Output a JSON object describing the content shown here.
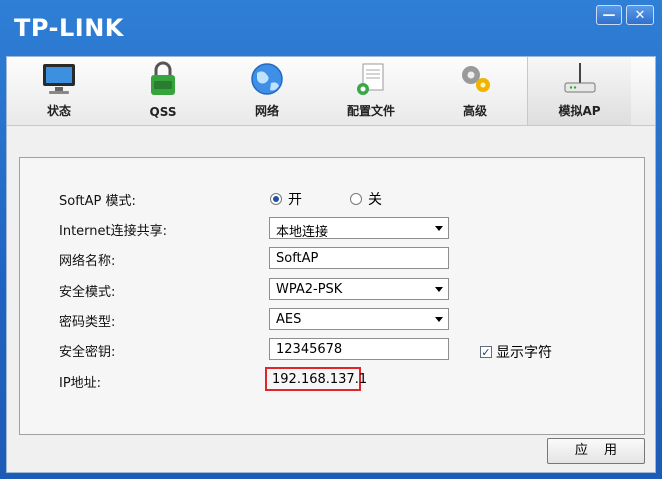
{
  "app": {
    "brand": "TP-LINK"
  },
  "window_controls": {
    "minimize": "—",
    "close": "✕"
  },
  "tabs": [
    {
      "label": "状态",
      "icon": "monitor-icon"
    },
    {
      "label": "QSS",
      "icon": "qss-lock-icon"
    },
    {
      "label": "网络",
      "icon": "globe-icon"
    },
    {
      "label": "配置文件",
      "icon": "document-gear-icon"
    },
    {
      "label": "高级",
      "icon": "gears-icon"
    },
    {
      "label": "模拟AP",
      "icon": "router-icon",
      "active": true
    }
  ],
  "form": {
    "softap_mode": {
      "label": "SoftAP 模式:",
      "on": "开",
      "off": "关",
      "selected": "on"
    },
    "internet_share": {
      "label": "Internet连接共享:",
      "value": "本地连接"
    },
    "network_name": {
      "label": "网络名称:",
      "value": "SoftAP"
    },
    "security_mode": {
      "label": "安全模式:",
      "value": "WPA2-PSK"
    },
    "cipher_type": {
      "label": "密码类型:",
      "value": "AES"
    },
    "security_key": {
      "label": "安全密钥:",
      "value": "12345678"
    },
    "show_chars": {
      "label": "显示字符",
      "checked": true,
      "mark": "✓"
    },
    "ip": {
      "label": "IP地址:",
      "value": "192.168.137.1"
    }
  },
  "buttons": {
    "apply": "应 用"
  },
  "colors": {
    "title_blue": "#1f63c0",
    "highlight_red": "#e0262b"
  }
}
